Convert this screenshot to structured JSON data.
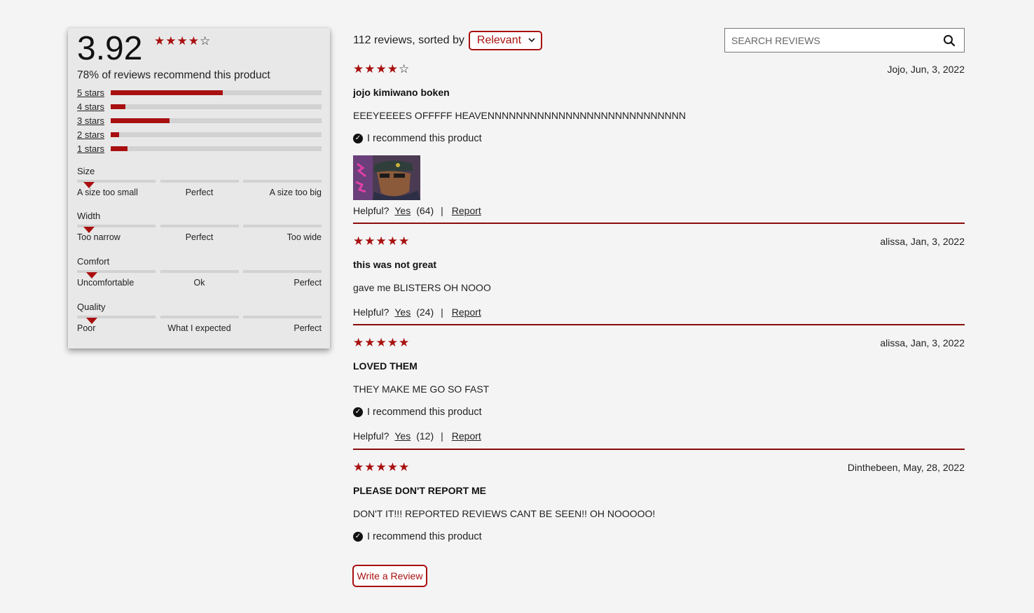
{
  "summary": {
    "average": "3.92",
    "average_rating": 3.92,
    "star_display": [
      1,
      1,
      1,
      1,
      0
    ],
    "recommend_text": "78% of reviews recommend this product",
    "breakdown": [
      {
        "label": "5 stars",
        "fraction": 0.53
      },
      {
        "label": "4 stars",
        "fraction": 0.07
      },
      {
        "label": "3 stars",
        "fraction": 0.28
      },
      {
        "label": "2 stars",
        "fraction": 0.04
      },
      {
        "label": "1 stars",
        "fraction": 0.08
      }
    ],
    "characteristics": [
      {
        "name": "Size",
        "value": 0.05,
        "labels": [
          "A size too small",
          "Perfect",
          "A size too big"
        ]
      },
      {
        "name": "Width",
        "value": 0.05,
        "labels": [
          "Too narrow",
          "Perfect",
          "Too wide"
        ]
      },
      {
        "name": "Comfort",
        "value": 0.06,
        "labels": [
          "Uncomfortable",
          "Ok",
          "Perfect"
        ]
      },
      {
        "name": "Quality",
        "value": 0.06,
        "labels": [
          "Poor",
          "What I expected",
          "Perfect"
        ]
      }
    ]
  },
  "header": {
    "count_text": "112 reviews, sorted by",
    "sort_selected": "Relevant",
    "search_placeholder": "SEARCH REVIEWS"
  },
  "reviews": [
    {
      "rating": 4,
      "date": "Jojo, Jun, 3, 2022",
      "title": "jojo kimiwano boken",
      "body": "EEEYEEEES OFFFFF HEAVENNNNNNNNNNNNNNNNNNNNNNNNNNNN",
      "recommend": "I recommend this product",
      "helpful_prefix": "Helpful?",
      "yes": "Yes",
      "count": "(64)",
      "sep": "|",
      "report": "Report"
    },
    {
      "rating": 5,
      "date": "alissa, Jan, 3, 2022",
      "title": "this was not great",
      "body": "gave me BLISTERS OH NOOO",
      "helpful_prefix": "Helpful?",
      "yes": "Yes",
      "count": "(24)",
      "sep": "|",
      "report": "Report"
    },
    {
      "rating": 5,
      "date": "alissa, Jan, 3, 2022",
      "title": "LOVED THEM",
      "body": "THEY MAKE ME GO SO FAST",
      "recommend": "I recommend this product",
      "helpful_prefix": "Helpful?",
      "yes": "Yes",
      "count": "(12)",
      "sep": "|",
      "report": "Report"
    },
    {
      "rating": 5,
      "date": "Dinthebeen, May, 28, 2022",
      "title": "PLEASE DON'T REPORT ME",
      "body": "DON'T IT!!! REPORTED REVIEWS CANT BE SEEN!! OH NOOOOO!",
      "recommend": "I recommend this product"
    }
  ],
  "write_review": "Write a Review",
  "colors": {
    "accent": "#a8100f",
    "divider": "#8b0b0b",
    "background": "#f4f4f4"
  }
}
